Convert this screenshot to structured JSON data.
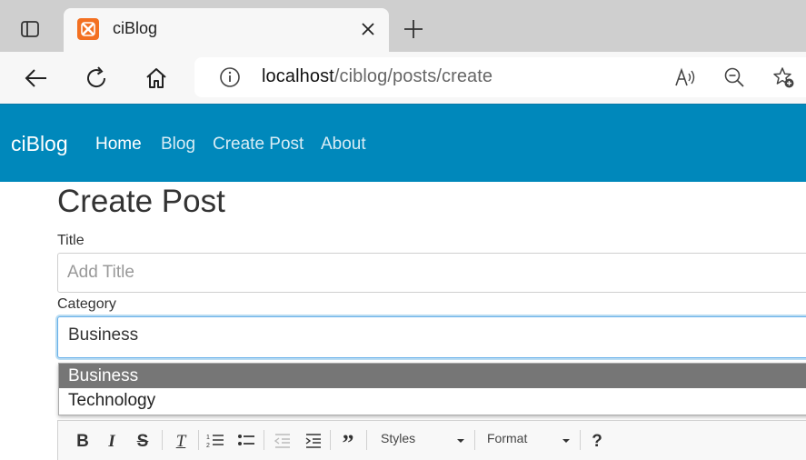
{
  "browser": {
    "tab_title": "ciBlog",
    "url_host": "localhost",
    "url_path": "/ciblog/posts/create"
  },
  "site": {
    "brand": "ciBlog",
    "nav": [
      {
        "label": "Home"
      },
      {
        "label": "Blog"
      },
      {
        "label": "Create Post"
      },
      {
        "label": "About"
      }
    ]
  },
  "form": {
    "heading": "Create Post",
    "title_label": "Title",
    "title_placeholder": "Add Title",
    "category_label": "Category",
    "category_selected": "Business",
    "category_options": [
      "Business",
      "Technology"
    ]
  },
  "editor": {
    "styles_label": "Styles",
    "format_label": "Format",
    "help_label": "?"
  },
  "colors": {
    "navbar": "#0088bb",
    "selected_option": "#767676",
    "favicon": "#f37021"
  }
}
